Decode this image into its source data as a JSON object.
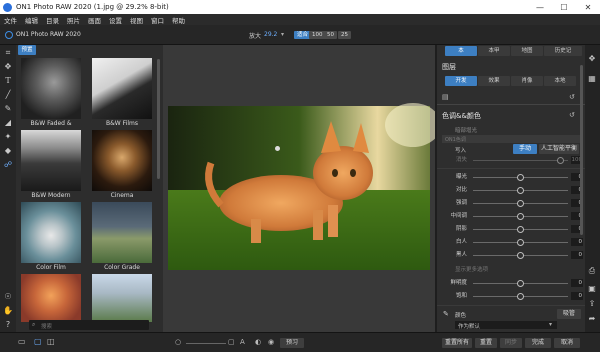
{
  "window": {
    "title": "ON1 Photo RAW 2020 (1.jpg @ 29.2% 8-bit)",
    "controls": [
      "—",
      "☐",
      "✕"
    ]
  },
  "menu": [
    "文件",
    "编辑",
    "目录",
    "照片",
    "画面",
    "设置",
    "视图",
    "窗口",
    "帮助"
  ],
  "topbar": {
    "app_name": "ON1 Photo RAW 2020",
    "zoom_label": "放大",
    "zoom_value": "29.2",
    "fit_label": "适合",
    "zoom_presets": [
      "100",
      "50",
      "25"
    ]
  },
  "presets": {
    "tab": "预置",
    "items": [
      {
        "caption": "B&W Faded & Matte"
      },
      {
        "caption": "B&W Films"
      },
      {
        "caption": "B&W Modern"
      },
      {
        "caption": "Cinema"
      },
      {
        "caption": "Color Film"
      },
      {
        "caption": "Color Grade"
      }
    ],
    "search_placeholder": "搜索"
  },
  "right": {
    "top_tabs": [
      "本",
      "本甲",
      "地图",
      "历史记"
    ],
    "section_title": "图层",
    "sub_tabs": [
      "开发",
      "效果",
      "肖像",
      "本地"
    ],
    "color_title": "色调&&颜色",
    "preset_hint": "暗部增光",
    "auto_hint": "ON1色调",
    "mode_label": "写入",
    "mode_btn1": "手动",
    "mode_btn2": "人工智能平衡",
    "faded_label": "消失",
    "faded_val": "100",
    "sliders": [
      {
        "label": "曝光",
        "value": "0",
        "pos": 0.5
      },
      {
        "label": "对比",
        "value": "0",
        "pos": 0.5
      },
      {
        "label": "强调",
        "value": "0",
        "pos": 0.5
      },
      {
        "label": "中间调",
        "value": "0",
        "pos": 0.5
      },
      {
        "label": "阴影",
        "value": "0",
        "pos": 0.5
      },
      {
        "label": "白人",
        "value": "0",
        "pos": 0.5
      },
      {
        "label": "黑人",
        "value": "0",
        "pos": 0.5
      }
    ],
    "show_more": "显示更多选项",
    "sliders2": [
      {
        "label": "鲜明度",
        "value": "0",
        "pos": 0.5
      },
      {
        "label": "饱和",
        "value": "0",
        "pos": 0.5
      }
    ],
    "color_picker_label": "颜色",
    "color_picker_btn": "吸管",
    "dropdown_value": "作为默认"
  },
  "bottom": {
    "center_btn": "预习",
    "buttons": [
      "重置所有",
      "重置",
      "同步",
      "完成",
      "取消"
    ]
  }
}
